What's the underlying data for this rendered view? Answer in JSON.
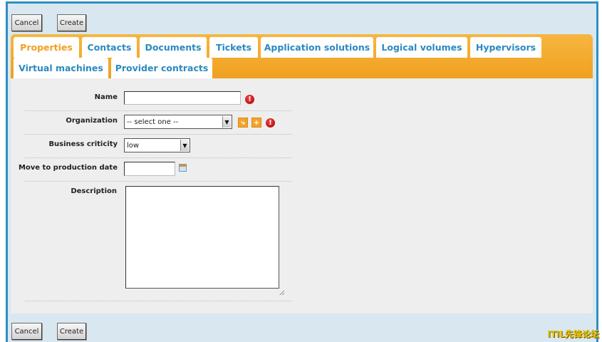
{
  "toolbar": {
    "cancel_label": "Cancel",
    "create_label": "Create"
  },
  "tabs": [
    {
      "label": "Properties",
      "active": true
    },
    {
      "label": "Contacts"
    },
    {
      "label": "Documents"
    },
    {
      "label": "Tickets"
    },
    {
      "label": "Application solutions"
    },
    {
      "label": "Logical volumes"
    },
    {
      "label": "Hypervisors"
    },
    {
      "label": "Virtual machines"
    },
    {
      "label": "Provider contracts"
    }
  ],
  "form": {
    "name": {
      "label": "Name",
      "value": ""
    },
    "organization": {
      "label": "Organization",
      "selected": "-- select one --"
    },
    "business_criticity": {
      "label": "Business criticity",
      "selected": "low"
    },
    "move_to_production_date": {
      "label": "Move to production date",
      "value": ""
    },
    "description": {
      "label": "Description",
      "value": ""
    }
  },
  "icons": {
    "mandatory": "!",
    "search": "⤷",
    "add": "+"
  },
  "colors": {
    "accent": "#f0a020",
    "tab_text": "#2a8ac0",
    "frame": "#2e8fc4",
    "error": "#cc0000"
  },
  "watermark": "ITIL先锋论坛"
}
